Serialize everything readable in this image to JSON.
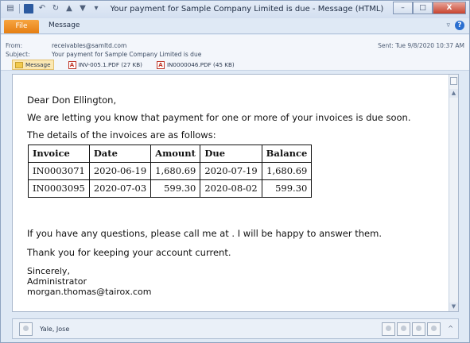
{
  "window": {
    "title": "Your payment for Sample Company Limited is due - Message (HTML)",
    "buttons": {
      "minimize": "–",
      "maximize": "□",
      "close": "X"
    }
  },
  "ribbon": {
    "file_tab": "File",
    "message_tab": "Message",
    "collapse_icon": "chevron-down-icon",
    "help_label": "?"
  },
  "header": {
    "from_label": "From:",
    "from_value": "receivables@samltd.com",
    "subject_label": "Subject:",
    "subject_value": "Your payment for Sample Company Limited is due",
    "sent_label": "Sent:",
    "sent_value": "Tue 9/8/2020 10:37 AM",
    "attachments": [
      {
        "label": "Message",
        "type": "message"
      },
      {
        "label": "INV-005.1.PDF (27 KB)",
        "type": "pdf"
      },
      {
        "label": "IN0000046.PDF (45 KB)",
        "type": "pdf"
      }
    ]
  },
  "body": {
    "greeting": "Dear Don Ellington,",
    "line1": "We are letting you know that payment for one or more of your invoices is due soon.",
    "line2": "The details of the invoices are as follows:",
    "table": {
      "headers": [
        "Invoice",
        "Date",
        "Amount",
        "Due",
        "Balance"
      ],
      "rows": [
        [
          "IN0003071",
          "2020-06-19",
          "1,680.69",
          "2020-07-19",
          "1,680.69"
        ],
        [
          "IN0003095",
          "2020-07-03",
          "599.30",
          "2020-08-02",
          "599.30"
        ]
      ]
    },
    "line3": "If you have any questions, please call me at . I will be happy to answer them.",
    "line4": "Thank you for keeping your account current.",
    "closing": "Sincerely,",
    "signer_title": "Administrator",
    "signer_email": "morgan.thomas@tairox.com"
  },
  "people_pane": {
    "name": "Yale, Jose",
    "toggle": "^"
  }
}
